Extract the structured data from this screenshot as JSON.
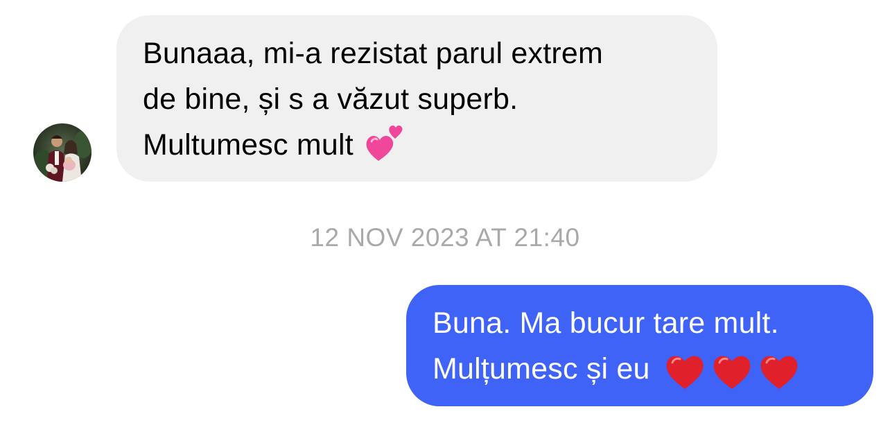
{
  "conversation": {
    "incoming_message": {
      "lines": [
        "Bunaaa, mi-a rezistat parul extrem",
        "de bine, și s a văzut superb.",
        "Multumesc mult"
      ],
      "emoji": "two-hearts-icon"
    },
    "timestamp": "12 NOV 2023 AT 21:40",
    "outgoing_message": {
      "lines": [
        "Buna. Ma bucur tare mult.",
        "Mulțumesc și eu"
      ],
      "emojis": [
        "red-heart-icon",
        "red-heart-icon",
        "red-heart-icon"
      ]
    }
  },
  "colors": {
    "incoming_bubble": "#f0f0f0",
    "outgoing_bubble": "#3f63f6",
    "timestamp_text": "#a9a9a9",
    "heart_red": "#e0202a",
    "two_hearts_pink": "#f0479a"
  }
}
